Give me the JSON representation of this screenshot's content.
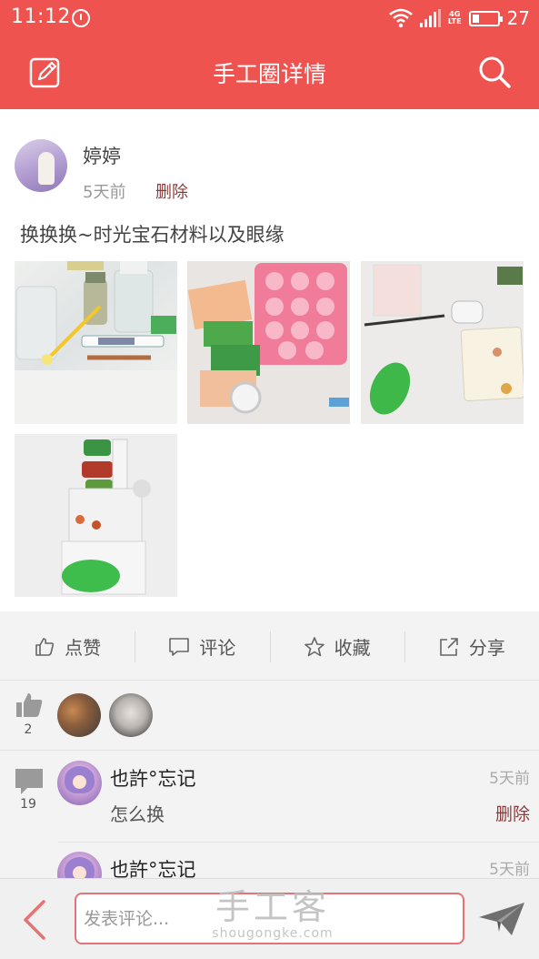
{
  "status_bar": {
    "time": "11:12",
    "network": "4G LTE",
    "battery_level": 27,
    "battery_text": "27"
  },
  "header": {
    "title": "手工圈详情",
    "left_icon": "edit-icon",
    "right_icon": "search-icon",
    "color": "#ef5350"
  },
  "post": {
    "username": "婷婷",
    "time": "5天前",
    "delete_label": "删除",
    "content": "换换换~时光宝石材料以及眼缘",
    "images": [
      "photo-1",
      "photo-2",
      "photo-3",
      "photo-4"
    ]
  },
  "actions": [
    {
      "label": "点赞",
      "icon": "thumbs-up-icon"
    },
    {
      "label": "评论",
      "icon": "comment-icon"
    },
    {
      "label": "收藏",
      "icon": "star-icon"
    },
    {
      "label": "分享",
      "icon": "share-icon"
    }
  ],
  "likes": {
    "count": "2",
    "icon": "thumbs-up-icon"
  },
  "comments": {
    "count": "19",
    "icon": "comment-icon",
    "items": [
      {
        "name": "也許°忘记",
        "time": "5天前",
        "text": "怎么换",
        "delete_label": "删除"
      },
      {
        "name": "也許°忘记",
        "time": "5天前"
      }
    ]
  },
  "bottom_bar": {
    "placeholder": "发表评论...",
    "back_icon": "back-chevron-icon",
    "send_icon": "send-icon",
    "accent": "#e57373"
  },
  "watermark": {
    "text": "手工客",
    "url": "shougongke.com"
  }
}
